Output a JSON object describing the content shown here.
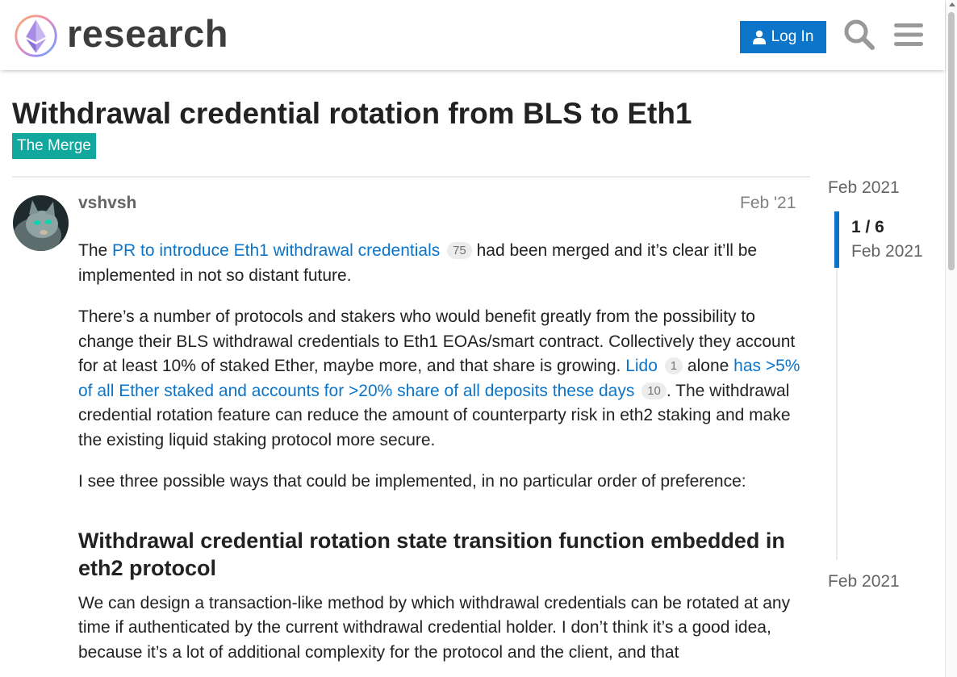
{
  "header": {
    "logo_text": "research",
    "login_label": "Log In",
    "search_icon": "search-icon",
    "menu_icon": "hamburger-menu-icon",
    "accent_color": "#0c75c9"
  },
  "topic": {
    "title": "Withdrawal credential rotation from BLS to Eth1",
    "category": "The Merge",
    "category_color": "#12a89d"
  },
  "post": {
    "author": "vshvsh",
    "date": "Feb '21",
    "p1_before": "The ",
    "p1_link": "PR to introduce Eth1 withdrawal credentials",
    "p1_link_clicks": "75",
    "p1_after": " had been merged and it’s clear it’ll be implemented in not so distant future.",
    "p2_before": "There’s a number of protocols and stakers who would benefit greatly from the possibility to change their BLS withdrawal credentials to Eth1 EOAs/smart contract. Collectively they account for at least 10% of staked Ether, maybe more, and that share is growing. ",
    "p2_link1": "Lido",
    "p2_link1_clicks": "1",
    "p2_mid": " alone ",
    "p2_link2": "has >5% of all Ether staked and accounts for >20% share of all deposits these days",
    "p2_link2_clicks": "10",
    "p2_after": ". The withdrawal credential rotation feature can reduce the amount of counterparty risk in eth2 staking and make the existing liquid staking protocol more secure.",
    "p3": "I see three possible ways that could be implemented, in no particular order of preference:",
    "h2": "Withdrawal credential rotation state transition function embedded in eth2 protocol",
    "p4": "We can design a transaction-like method by which withdrawal credentials can be rotated at any time if authenticated by the current withdrawal credential holder. I don’t think it’s a good idea, because it’s a lot of additional complexity for the protocol and the client, and that"
  },
  "timeline": {
    "top_date": "Feb 2021",
    "counter": "1 / 6",
    "counter_date": "Feb 2021",
    "bottom_date": "Feb 2021"
  }
}
